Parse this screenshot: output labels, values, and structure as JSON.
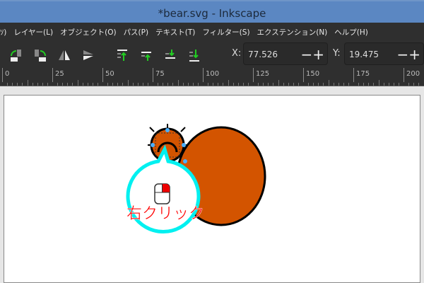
{
  "window": {
    "title": "*bear.svg - Inkscape"
  },
  "menu": [
    "ｿ)",
    "レイヤー(L)",
    "オブジェクト(O)",
    "パス(P)",
    "テキスト(T)",
    "フィルター(S)",
    "エクステンション(N)",
    "ヘルプ(H)"
  ],
  "toolbar": {
    "icons": [
      "rotate-ccw-icon",
      "rotate-cw-icon",
      "flip-horizontal-icon",
      "flip-vertical-icon",
      "raise-to-top-icon",
      "raise-icon",
      "lower-icon",
      "lower-to-bottom-icon"
    ],
    "x_label": "X:",
    "x_value": "77.526",
    "y_label": "Y:",
    "y_value": "19.475",
    "pm": "−+"
  },
  "ruler": [
    "0",
    "25",
    "50",
    "75",
    "100",
    "125",
    "150",
    "175",
    "200"
  ],
  "canvas": {
    "fill_color": "#d35400",
    "callout_color": "#00f0f0",
    "callout_text": "右クリック",
    "callout_text_color": "#ff0000"
  }
}
